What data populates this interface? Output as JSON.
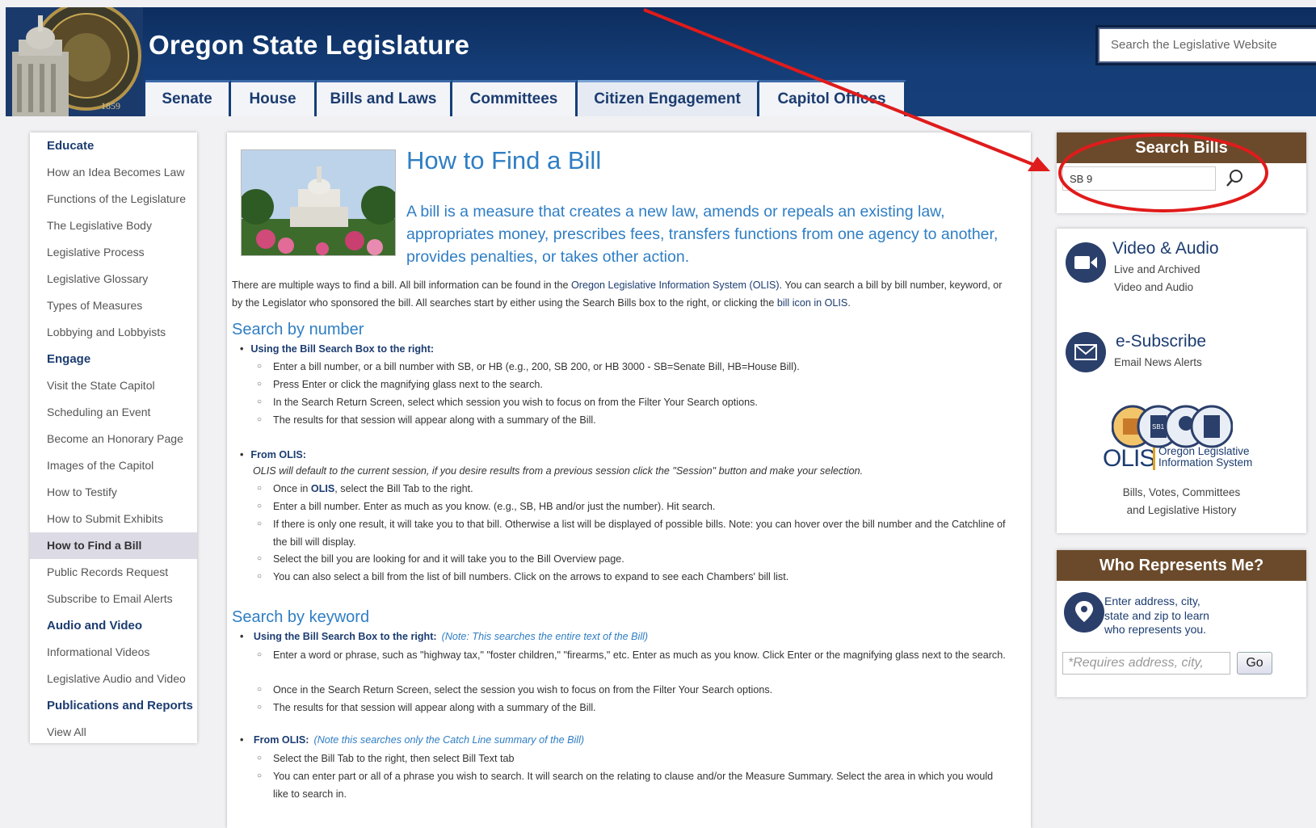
{
  "header": {
    "site_title": "Oregon State Legislature",
    "search_placeholder": "Search the Legislative Website",
    "tabs": [
      {
        "label": "Senate"
      },
      {
        "label": "House"
      },
      {
        "label": "Bills and Laws"
      },
      {
        "label": "Committees"
      },
      {
        "label": "Citizen Engagement"
      },
      {
        "label": "Capitol Offices"
      }
    ],
    "seal_year": "1859"
  },
  "sidebar": {
    "items": [
      {
        "label": "Educate",
        "kind": "head"
      },
      {
        "label": "How an Idea Becomes Law"
      },
      {
        "label": "Functions of the Legislature"
      },
      {
        "label": "The Legislative Body"
      },
      {
        "label": "Legislative Process"
      },
      {
        "label": "Legislative Glossary"
      },
      {
        "label": "Types of Measures"
      },
      {
        "label": "Lobbying and Lobbyists"
      },
      {
        "label": "Engage",
        "kind": "head"
      },
      {
        "label": "Visit the State Capitol"
      },
      {
        "label": "Scheduling an Event"
      },
      {
        "label": "Become an Honorary Page"
      },
      {
        "label": "Images of the Capitol"
      },
      {
        "label": "How to Testify"
      },
      {
        "label": "How to Submit Exhibits"
      },
      {
        "label": "How to Find a Bill",
        "kind": "current"
      },
      {
        "label": "Public Records Request"
      },
      {
        "label": "Subscribe to Email Alerts"
      },
      {
        "label": "Audio and Video",
        "kind": "head"
      },
      {
        "label": "Informational Videos"
      },
      {
        "label": "Legislative Audio and Video"
      },
      {
        "label": "Publications and Reports",
        "kind": "head"
      },
      {
        "label": "View All"
      }
    ]
  },
  "main": {
    "title": "How to Find a Bill",
    "lead": "A bill is a measure that creates a new law, amends or repeals an existing law, appropriates money, prescribes fees, transfers functions from one agency to another, provides penalties, or takes other action.",
    "intro_1": "There are multiple ways to find a bill.  All bill information can be found in the ",
    "intro_link": "Oregon Legislative Information System (OLIS)",
    "intro_2": ".  You can search a bill by bill number, keyword, or by the Legislator who sponsored the bill.  All searches start by either using the Search Bills box to the right, or clicking the ",
    "intro_link2": "bill icon in OLIS",
    "intro_3": ".",
    "s1_title": "Search by number",
    "s1_b1": "Using the Bill Search Box to the right:",
    "s1_b1_items": [
      "Enter a bill number, or a bill number with SB, or HB (e.g., 200, SB 200, or HB 3000 - SB=Senate Bill, HB=House Bill).",
      "Press Enter or click the magnifying glass next to the search.",
      " In the Search Return Screen, select which session you wish to focus on from the Filter Your Search options.",
      "The results for that session will appear along with a summary of the Bill."
    ],
    "s1_b2": "From OLIS:",
    "s1_b2_note": "OLIS will default to the current session, if you desire results from a previous session click the \"Session\" button and make your selection.",
    "s1_b2_first_pre": "Once in ",
    "s1_b2_first_link": "OLIS",
    "s1_b2_first_post": ", select the Bill Tab to the right.",
    "s1_b2_items": [
      "Enter a bill number. Enter as much as you know. (e.g., SB, HB and/or just the number). Hit search.",
      "If there is only one result, it will take you to that bill. Otherwise a list will be displayed of possible bills. Note: you can hover over the bill number and the Catchline of the bill will display.",
      "Select the bill you are looking for and it will take you to the Bill Overview page.",
      "You can also select a bill from the list of bill numbers. Click on the arrows to expand to see each Chambers' bill list."
    ],
    "s2_title": "Search by keyword",
    "s2_b1": "Using the  Bill Search Box to the right:",
    "s2_b1_note": "(Note: This searches the entire text of the Bill)",
    "s2_b1_items": [
      "Enter a word or phrase, such as \"highway tax,\" \"foster children,\" \"firearms,\" etc. Enter as much as you know. Click Enter or the magnifying glass next to the search.",
      "Once in the Search Return Screen, select the session you wish to focus on from the Filter Your Search options.",
      "The results for that session will appear along with a summary of the Bill."
    ],
    "s2_b2": "From OLIS",
    "s2_b2_note": "(Note this searches only the Catch Line summary of the Bill)",
    "s2_b2_items": [
      "Select the Bill Tab to the right, then select Bill Text tab",
      "You can enter part or all of a phrase you wish to search. It will search on the relating to clause and/or the Measure Summary. Select the area in which you would like to search in."
    ]
  },
  "right": {
    "search_bills_title": "Search Bills",
    "search_bills_value": "SB 9",
    "video_title": "Video & Audio",
    "video_sub1": "Live and Archived",
    "video_sub2": "Video and Audio",
    "esub_title": "e-Subscribe",
    "esub_sub": "Email News Alerts",
    "olis_logo_word": "OLIS",
    "olis_logo_line1": "Oregon Legislative",
    "olis_logo_line2": "Information System",
    "olis_badge": "SB1",
    "olis_sub1": "Bills, Votes, Committees",
    "olis_sub2": "and Legislative History",
    "who_title": "Who Represents Me?",
    "who_text": "Enter address, city, state and zip to learn who represents you.",
    "who_placeholder": "*Requires address, city,",
    "go_label": "Go"
  },
  "colors": {
    "header_blue": "#153e78",
    "accent_blue": "#2f7ec4",
    "navy": "#1c3c70",
    "brown": "#6b4a2b",
    "annotation_red": "#e01b1b"
  }
}
